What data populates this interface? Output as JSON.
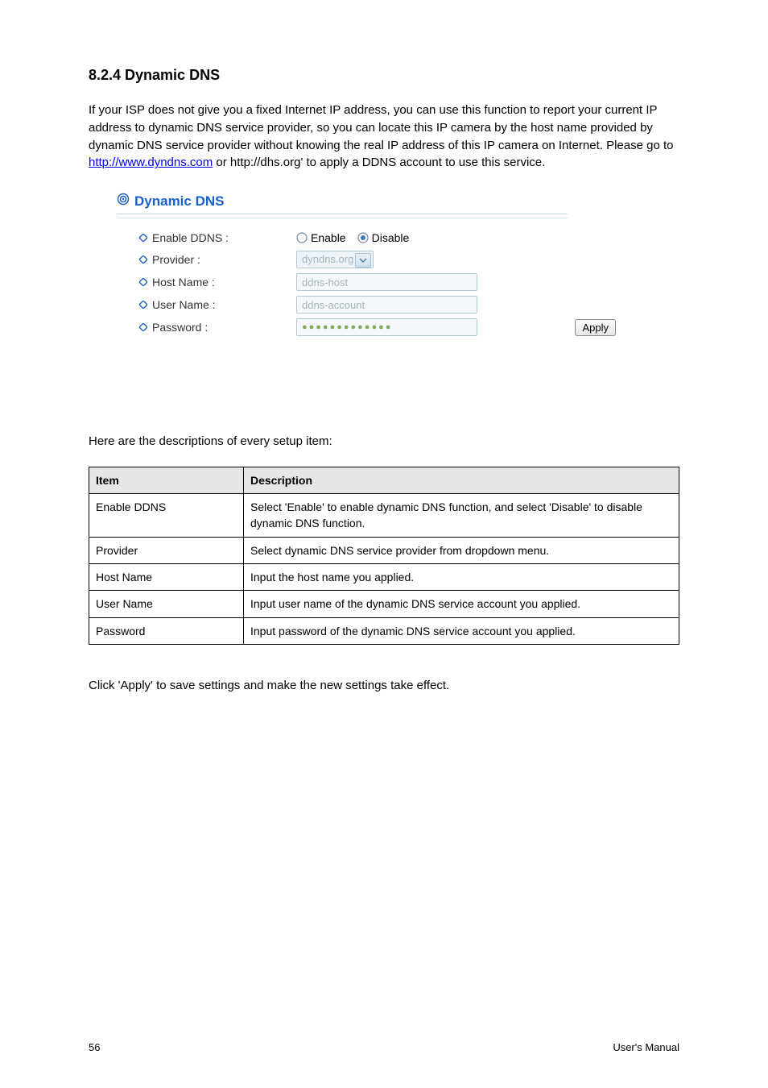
{
  "heading": "8.2.4 Dynamic DNS",
  "intro_segments": {
    "s1": "If your ISP does not give you a fixed Internet IP address, you can use this function to report your current IP address to dynamic DNS service provider, so you can locate this IP camera by the host name provided by dynamic DNS service provider without knowing the real IP address of this IP camera on Internet. Please go to ",
    "link_text": "http://www.dyndns.com",
    "s2": " or http://dhs.org' to apply a DDNS account to use this service."
  },
  "screenshot": {
    "title": "Dynamic DNS",
    "labels": {
      "enable": "Enable DDNS :",
      "provider": "Provider :",
      "hostname": "Host Name :",
      "username": "User Name :",
      "password": "Password :"
    },
    "radio": {
      "enable": "Enable",
      "disable": "Disable"
    },
    "values": {
      "provider": "dyndns.org",
      "hostname": "ddns-host",
      "username": "ddns-account",
      "password": "●●●●●●●●●●●●●"
    },
    "apply": "Apply"
  },
  "fields_intro": "Here are the descriptions of every setup item:",
  "table": {
    "head": {
      "item": "Item",
      "desc": "Description"
    },
    "rows": [
      {
        "item": "Enable DDNS",
        "desc": "Select 'Enable' to enable dynamic DNS function, and select 'Disable' to disable dynamic DNS function."
      },
      {
        "item": "Provider",
        "desc": "Select dynamic DNS service provider from dropdown menu."
      },
      {
        "item": "Host Name",
        "desc": "Input the host name you applied."
      },
      {
        "item": "User Name",
        "desc": "Input user name of the dynamic DNS service account you applied."
      },
      {
        "item": "Password",
        "desc": "Input password of the dynamic DNS service account you applied."
      }
    ]
  },
  "closing": "Click 'Apply' to save settings and make the new settings take effect.",
  "footer": {
    "page": "56",
    "manual": "User's Manual"
  }
}
